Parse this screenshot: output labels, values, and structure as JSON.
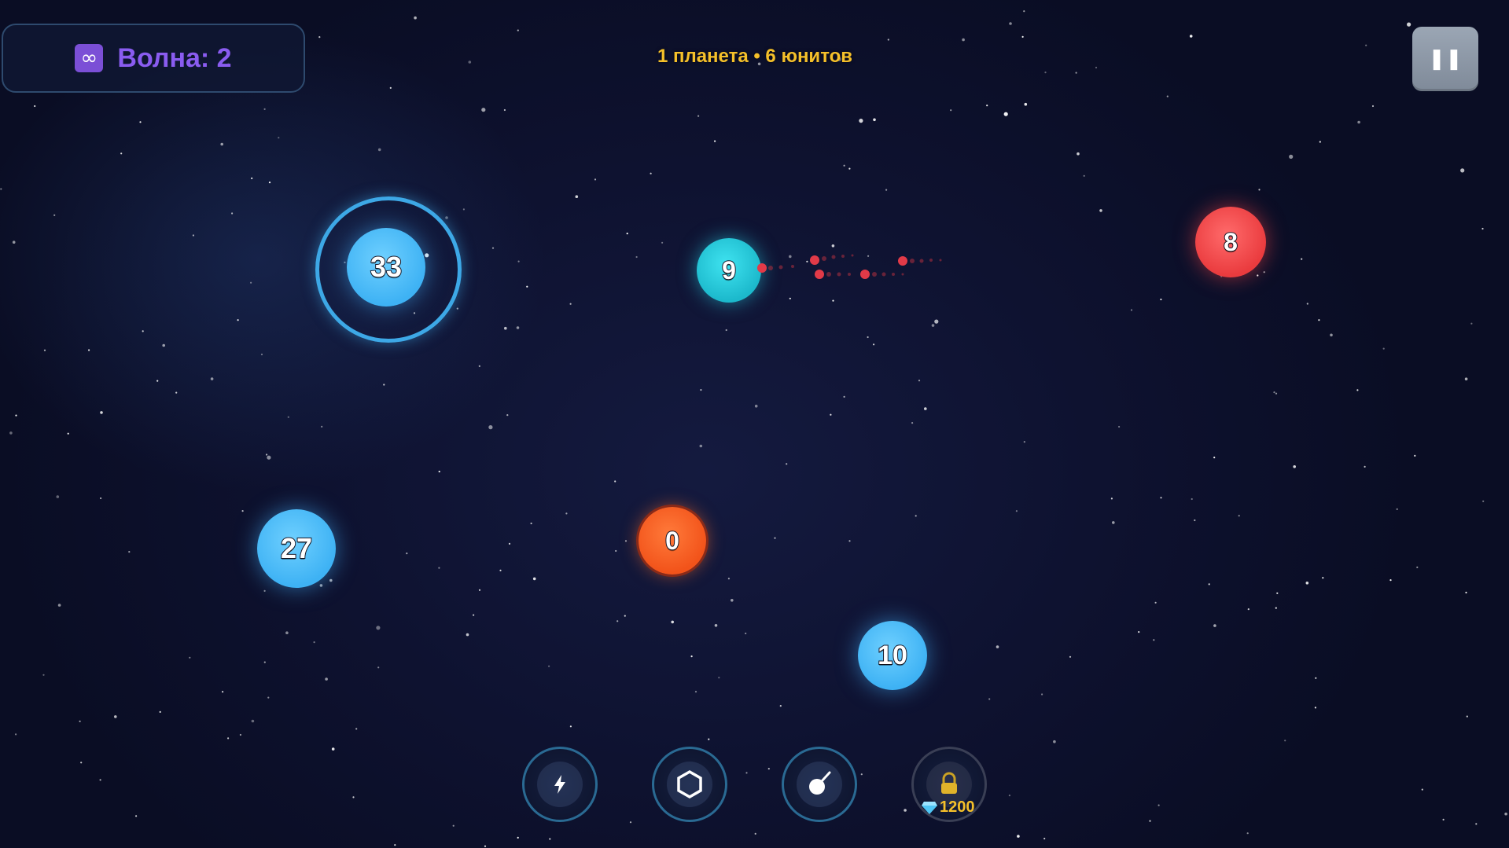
{
  "hud": {
    "wave_label": "Волна: 2",
    "wave_icon": "infinity-icon",
    "status_text": "1 планета • 6 юнитов",
    "pause_icon": "pause-icon"
  },
  "planets": [
    {
      "id": "planet-33",
      "count": "33",
      "owner": "player",
      "color": "#3eb2f4",
      "selected": true
    },
    {
      "id": "planet-9",
      "count": "9",
      "owner": "ally",
      "color": "#1cb9cc"
    },
    {
      "id": "planet-8",
      "count": "8",
      "owner": "enemy",
      "color": "#ea3b3e"
    },
    {
      "id": "planet-27",
      "count": "27",
      "owner": "player",
      "color": "#3eb2f4"
    },
    {
      "id": "planet-0",
      "count": "0",
      "owner": "enemy-orange",
      "color": "#f2531a"
    },
    {
      "id": "planet-10",
      "count": "10",
      "owner": "player",
      "color": "#3eb2f4"
    }
  ],
  "abilities": [
    {
      "name": "lightning-ability",
      "icon": "lightning-icon",
      "locked": false
    },
    {
      "name": "shield-ability",
      "icon": "hexagon-shield-icon",
      "locked": false
    },
    {
      "name": "bomb-ability",
      "icon": "bomb-icon",
      "locked": false
    },
    {
      "name": "locked-ability",
      "icon": "padlock-icon",
      "locked": true,
      "price": "1200",
      "price_icon": "gem-icon"
    }
  ],
  "colors": {
    "player": "#3eb2f4",
    "enemy": "#ea3b3e",
    "wave_text": "#8a5cf0",
    "status_text": "#f5c02a"
  }
}
